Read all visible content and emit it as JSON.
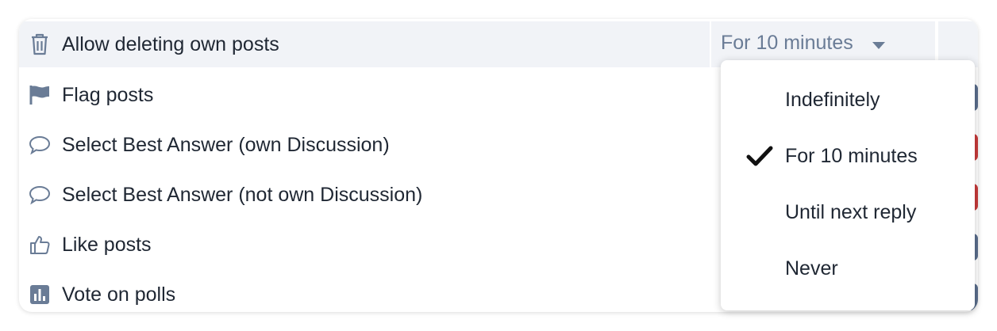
{
  "permissions": {
    "rows": [
      {
        "label": "Allow deleting own posts",
        "icon": "trash-icon"
      },
      {
        "label": "Flag posts",
        "icon": "flag-icon"
      },
      {
        "label": "Select Best Answer (own Discussion)",
        "icon": "comment-icon"
      },
      {
        "label": "Select Best Answer (not own Discussion)",
        "icon": "comment-icon"
      },
      {
        "label": "Like posts",
        "icon": "thumbs-up-icon"
      },
      {
        "label": "Vote on polls",
        "icon": "poll-icon"
      }
    ]
  },
  "select": {
    "value": "For 10 minutes"
  },
  "dropdown": {
    "options": [
      "Indefinitely",
      "For 10 minutes",
      "Until next reply",
      "Never"
    ],
    "selected": "For 10 minutes"
  },
  "colors": {
    "icon": "#6a7c96",
    "header_bg": "#f1f3f7",
    "badge_blue": "#5a6e8c",
    "badge_red": "#c73a3a"
  }
}
